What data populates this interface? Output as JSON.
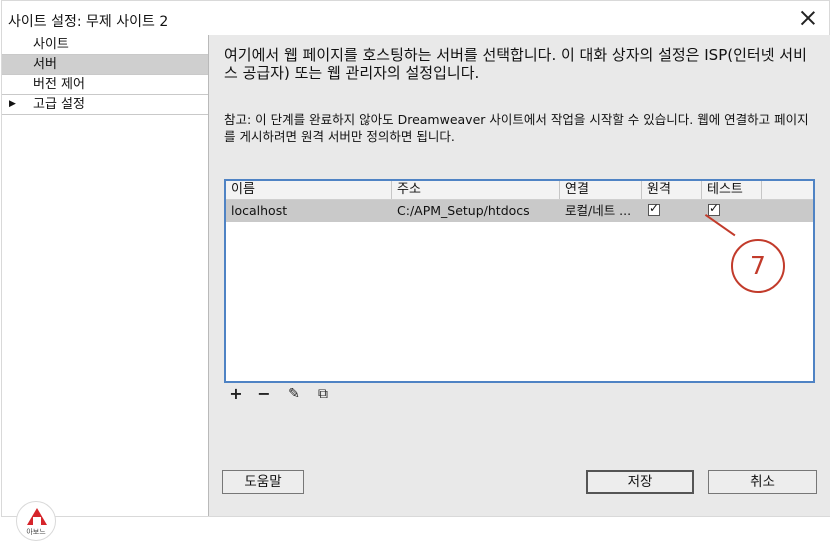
{
  "window": {
    "title": "사이트 설정: 무제 사이트 2"
  },
  "sidebar": {
    "items": [
      {
        "label": "사이트",
        "selected": false
      },
      {
        "label": "서버",
        "selected": true
      },
      {
        "label": "버전 제어",
        "selected": false
      },
      {
        "label": "고급 설정",
        "selected": false,
        "expand_icon": "triangle-right-icon"
      }
    ],
    "logo_text": "아보느"
  },
  "main": {
    "description": "여기에서 웹 페이지를 호스팅하는 서버를 선택합니다. 이 대화 상자의 설정은 ISP(인터넷 서비스 공급자) 또는 웹 관리자의 설정입니다.",
    "note": "참고: 이 단계를 완료하지 않아도 Dreamweaver 사이트에서 작업을 시작할 수 있습니다. 웹에 연결하고 페이지를 게시하려면 원격 서버만 정의하면 됩니다."
  },
  "server_table": {
    "columns": [
      "이름",
      "주소",
      "연결",
      "원격",
      "테스트"
    ],
    "rows": [
      {
        "name": "localhost",
        "address": "C:/APM_Setup/htdocs",
        "connection": "로컬/네트 ...",
        "remote": true,
        "test": true
      }
    ]
  },
  "toolbar": {
    "icons": [
      "plus-icon",
      "minus-icon",
      "pencil-icon",
      "duplicate-icon"
    ]
  },
  "buttons": {
    "help": "도움말",
    "save": "저장",
    "cancel": "취소"
  },
  "annotation": {
    "label": "7",
    "color": "#c23b2b"
  },
  "colors": {
    "accent": "#4f83c4",
    "selected_row": "#c9c9c9",
    "panel_bg": "#e9e9e9"
  }
}
